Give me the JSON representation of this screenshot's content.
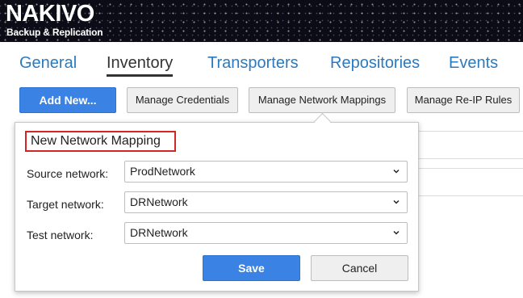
{
  "header": {
    "logo_main": "NAKIVO",
    "logo_sub": "Backup & Replication"
  },
  "tabs": [
    {
      "label": "General"
    },
    {
      "label": "Inventory",
      "active": true
    },
    {
      "label": "Transporters"
    },
    {
      "label": "Repositories"
    },
    {
      "label": "Events"
    }
  ],
  "toolbar": {
    "add_new": "Add New...",
    "manage_credentials": "Manage Credentials",
    "manage_network_mappings": "Manage Network Mappings",
    "manage_reip_rules": "Manage Re-IP Rules"
  },
  "popover": {
    "title": "New Network Mapping",
    "fields": [
      {
        "label": "Source network:",
        "value": "ProdNetwork"
      },
      {
        "label": "Target network:",
        "value": "DRNetwork"
      },
      {
        "label": "Test network:",
        "value": "DRNetwork"
      }
    ],
    "save_label": "Save",
    "cancel_label": "Cancel"
  },
  "colors": {
    "accent": "#3a82e4",
    "tab_link": "#2a7ac0",
    "highlight_border": "#d32525"
  }
}
